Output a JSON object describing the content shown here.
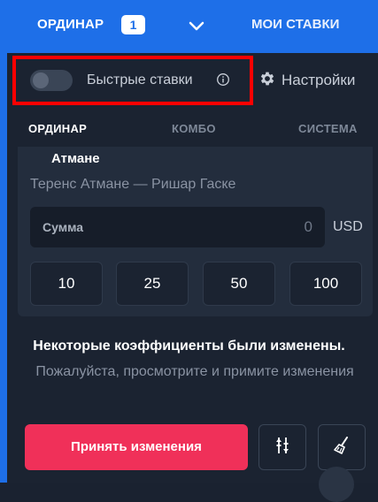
{
  "header": {
    "tab_single_label": "ОРДИНАР",
    "bet_count": "1",
    "tab_mybets_label": "МОИ СТАВКИ"
  },
  "quick_bets": {
    "label": "Быстрые ставки",
    "enabled": false,
    "settings_label": "Настройки"
  },
  "subtabs": [
    {
      "label": "ОРДИНАР",
      "active": true
    },
    {
      "label": "КОМБО",
      "active": false
    },
    {
      "label": "СИСТЕМА",
      "active": false
    }
  ],
  "bet": {
    "event_name": "Атмане",
    "match": "Теренс Атмане — Ришар Гаске",
    "amount_placeholder": "Сумма",
    "amount_value": "0",
    "currency": "USD",
    "quick_amounts": [
      "10",
      "25",
      "50",
      "100"
    ]
  },
  "notice": {
    "title": "Некоторые коэффициенты были изменены.",
    "subtitle": "Пожалуйста, просмотрите и примите изменения"
  },
  "actions": {
    "accept_label": "Принять изменения"
  },
  "colors": {
    "brand_blue": "#1e6fe8",
    "accept_red": "#f03059",
    "highlight_red": "#ff0000"
  }
}
